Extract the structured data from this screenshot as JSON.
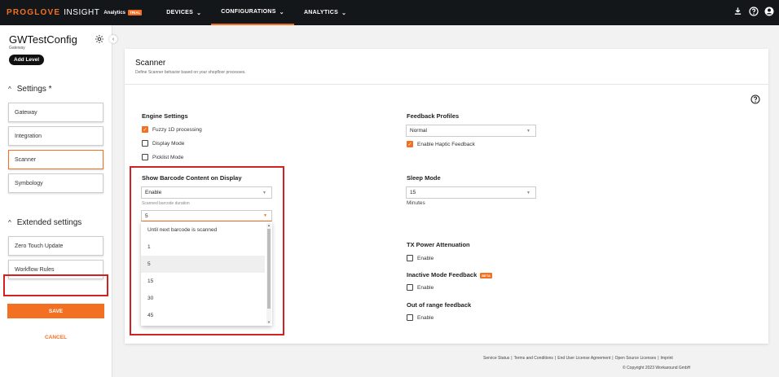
{
  "brand": {
    "name": "PROGLOVE",
    "product": "INSIGHT",
    "module": "Analytics",
    "badge": "TRIAL",
    "accent_color": "#f36f21"
  },
  "nav": [
    {
      "label": "DEVICES",
      "active": false
    },
    {
      "label": "CONFIGURATIONS",
      "active": true
    },
    {
      "label": "ANALYTICS",
      "active": false
    }
  ],
  "top_icons": [
    "download-icon",
    "help-circle-icon",
    "account-icon"
  ],
  "sidebar": {
    "title": "GWTestConfig",
    "subtitle": "Gateway",
    "add_level_label": "Add Level",
    "settings_heading": "Settings *",
    "settings_items": [
      {
        "label": "Gateway",
        "active": false
      },
      {
        "label": "Integration",
        "active": false
      },
      {
        "label": "Scanner",
        "active": true
      },
      {
        "label": "Symbology",
        "active": false
      }
    ],
    "extended_heading": "Extended settings",
    "extended_items": [
      {
        "label": "Zero Touch Update"
      },
      {
        "label": "Workflow Rules"
      }
    ],
    "save_label": "SAVE",
    "cancel_label": "CANCEL"
  },
  "card": {
    "title": "Scanner",
    "description": "Define Scanner behavior based on your shopfloor processes.",
    "engine": {
      "heading": "Engine Settings",
      "options": [
        {
          "label": "Fuzzy 1D processing",
          "checked": true
        },
        {
          "label": "Display Mode",
          "checked": false
        },
        {
          "label": "Picklist Mode",
          "checked": false
        }
      ]
    },
    "barcode_display": {
      "heading": "Show Barcode Content on Display",
      "value": "Enable",
      "duration_label": "Scanned barcode duration",
      "duration_value": "5",
      "duration_options": [
        "Until next barcode is scanned",
        "1",
        "5",
        "15",
        "30",
        "45"
      ],
      "selected_option": "5"
    },
    "feedback": {
      "heading": "Feedback Profiles",
      "value": "Normal",
      "haptic_label": "Enable Haptic Feedback",
      "haptic_checked": true
    },
    "sleep": {
      "heading": "Sleep Mode",
      "value": "15",
      "unit": "Minutes"
    },
    "tx_power": {
      "heading": "TX Power Attenuation",
      "enable_label": "Enable",
      "checked": false
    },
    "inactive": {
      "heading": "Inactive Mode Feedback",
      "badge": "BETA",
      "enable_label": "Enable",
      "checked": false
    },
    "out_of_range": {
      "heading": "Out of range feedback",
      "enable_label": "Enable",
      "checked": false
    }
  },
  "footer": {
    "links": [
      "Service Status",
      "Terms and Conditions",
      "End User License Agreement",
      "Open Source Licenses",
      "Imprint"
    ],
    "copyright": "© Copyright 2023 Workaround GmbH"
  }
}
